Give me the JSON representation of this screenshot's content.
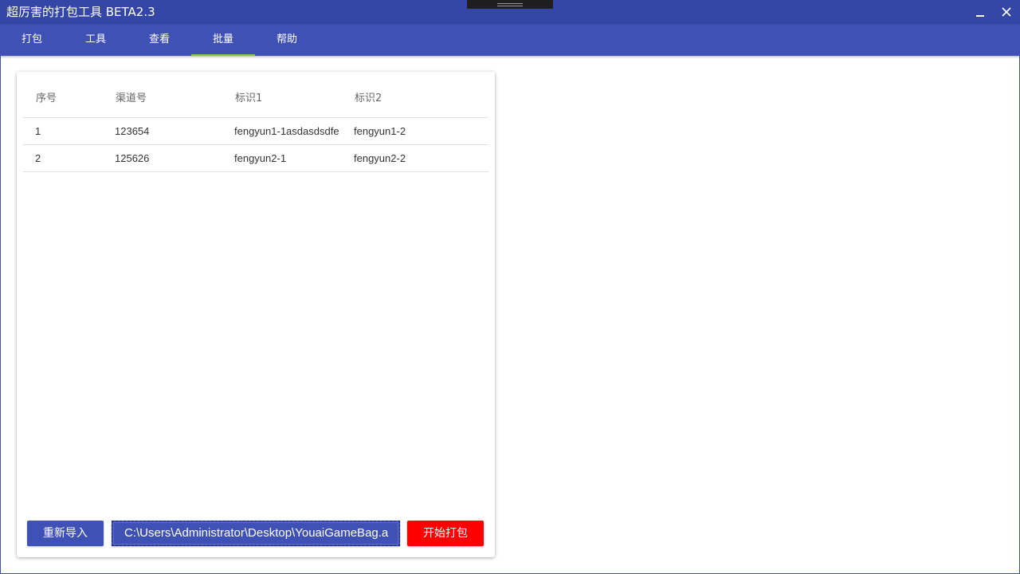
{
  "window": {
    "title": "超厉害的打包工具 BETA2.3",
    "minimize_icon": "minimize-icon",
    "close_icon": "close-icon"
  },
  "menu": {
    "tabs": [
      {
        "label": "打包"
      },
      {
        "label": "工具"
      },
      {
        "label": "查看"
      },
      {
        "label": "批量",
        "active": true
      },
      {
        "label": "帮助"
      }
    ],
    "accent_color": "#3f51b5",
    "active_indicator_color": "#8bc34a"
  },
  "table": {
    "headers": [
      "序号",
      "渠道号",
      "标识1",
      "标识2"
    ],
    "rows": [
      [
        "1",
        "123654",
        "fengyun1-1asdasdsdfe",
        "fengyun1-2"
      ],
      [
        "2",
        "125626",
        "fengyun2-1",
        "fengyun2-2"
      ]
    ]
  },
  "actions": {
    "reimport_label": "重新导入",
    "path_value": "C:\\Users\\Administrator\\Desktop\\YouaiGameBag.a",
    "start_label": "开始打包",
    "start_color": "#ff0000"
  }
}
